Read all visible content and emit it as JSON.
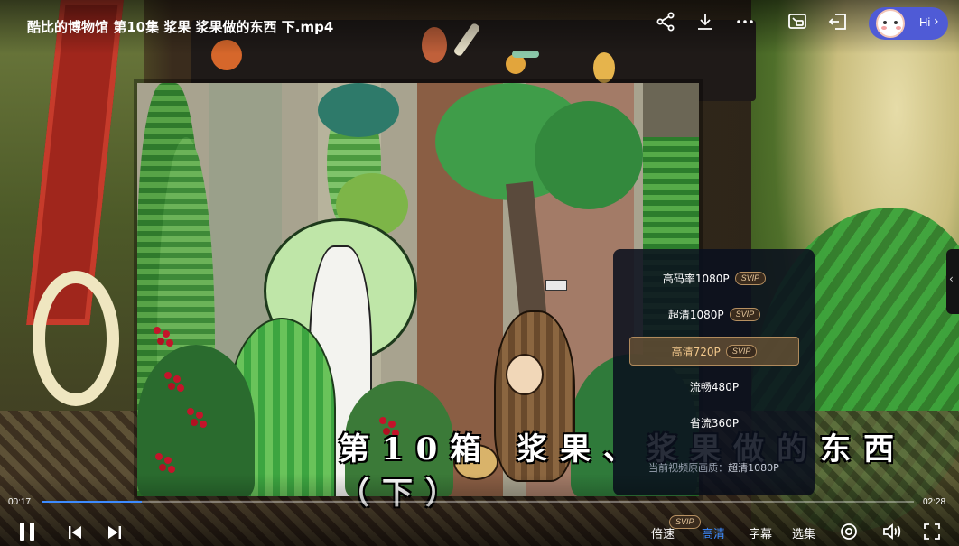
{
  "player": {
    "title": "酷比的博物馆 第10集 浆果 浆果做的东西 下.mp4",
    "subtitle": "第10箱 浆果、浆果做的东西（下）",
    "accent_color": "#3d8bff",
    "topbar": {
      "icons": [
        "share-icon",
        "download-icon",
        "more-icon",
        "picture-in-picture-icon",
        "exit-window-icon"
      ],
      "assistant_button": {
        "label": "Hi",
        "icon": "assistant-avatar-icon",
        "color": "#4f5bd6"
      }
    },
    "progress": {
      "current_time": "00:17",
      "total_time": "02:28",
      "fraction": 0.115
    },
    "quality_menu": {
      "items": [
        {
          "label": "高码率1080P",
          "badge": "SVIP",
          "selected": false
        },
        {
          "label": "超清1080P",
          "badge": "SVIP",
          "selected": false
        },
        {
          "label": "高清720P",
          "badge": "SVIP",
          "selected": true
        },
        {
          "label": "流畅480P",
          "badge": "",
          "selected": false
        },
        {
          "label": "省流360P",
          "badge": "",
          "selected": false
        }
      ],
      "current_label": "当前视频原画质：",
      "current_value": "超清1080P"
    },
    "controls": {
      "speed": {
        "label": "倍速",
        "badge": "SVIP"
      },
      "quality": {
        "label": "高清"
      },
      "subtitles": {
        "label": "字幕"
      },
      "episodes": {
        "label": "选集"
      },
      "icons": [
        "pause-icon",
        "previous-icon",
        "next-icon",
        "picture-mode-icon",
        "volume-icon",
        "fullscreen-icon"
      ]
    }
  }
}
